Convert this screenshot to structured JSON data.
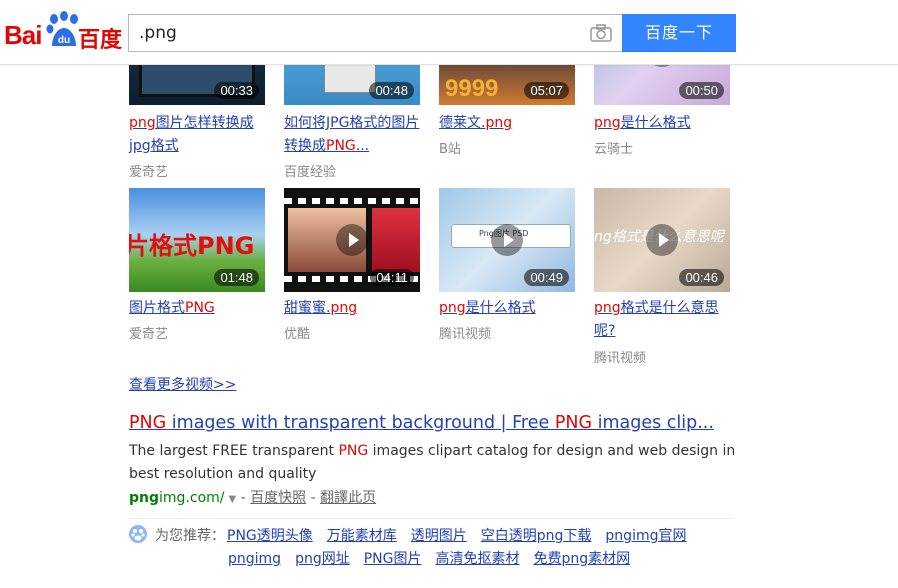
{
  "header": {
    "logo_bai": "Bai",
    "logo_du": "du",
    "logo_cn": "百度",
    "query": ".png",
    "search_button": "百度一下"
  },
  "videos_row1": [
    {
      "duration": "00:33",
      "title_hl": "png",
      "title_rest": "图片怎样转换成jpg格式",
      "source": "爱奇艺"
    },
    {
      "duration": "00:48",
      "title_pre": "如何将JPG格式的图片转换成",
      "title_hl": "PNG",
      "title_rest": "...",
      "source": "百度经验"
    },
    {
      "duration": "05:07",
      "title_pre": "德莱文.",
      "title_hl": "png",
      "source": "B站",
      "thumb_text": "9999"
    },
    {
      "duration": "00:50",
      "title_hl": "png",
      "title_rest": "是什么格式",
      "source": "云骑士"
    }
  ],
  "videos_row2": [
    {
      "duration": "01:48",
      "title_pre": "图片格式",
      "title_hl": "PNG",
      "source": "爱奇艺",
      "thumb_text": "片格式PNG"
    },
    {
      "duration": "04:11",
      "title_pre": "甜蜜蜜.",
      "title_hl": "png",
      "source": "优酷"
    },
    {
      "duration": "00:49",
      "title_hl": "png",
      "title_rest": "是什么格式",
      "source": "腾讯视频",
      "thumb_text": "Png图片 PSD"
    },
    {
      "duration": "00:46",
      "title_hl": "png",
      "title_rest": "格式是什么意思呢?",
      "source": "腾讯视频",
      "thumb_text": "ng格式是什么意思呢"
    }
  ],
  "more_videos": "查看更多视频>>",
  "result": {
    "title_hl1": "PNG",
    "title_mid": " images with transparent background | Free ",
    "title_hl2": "PNG",
    "title_end": " images clip...",
    "desc_pre": "The largest FREE transparent ",
    "desc_hl": "PNG",
    "desc_post": " images clipart catalog for design and web design in best resolution and quality",
    "url_bold": "png",
    "url_rest": "img.com/",
    "snapshot": "百度快照",
    "translate": "翻譯此页",
    "dash": " - "
  },
  "recommend": {
    "label": "为您推荐：",
    "links": [
      "PNG透明头像",
      "万能素材库",
      "透明图片",
      "空白透明png下载",
      "pngimg官网",
      "pngimg",
      "png网址",
      "PNG图片",
      "高清免抠素材",
      "免费png素材网"
    ]
  },
  "colors": {
    "brand_red": "#e10602",
    "brand_blue": "#3385ff",
    "link_blue": "#2440b3",
    "url_green": "#008000"
  }
}
